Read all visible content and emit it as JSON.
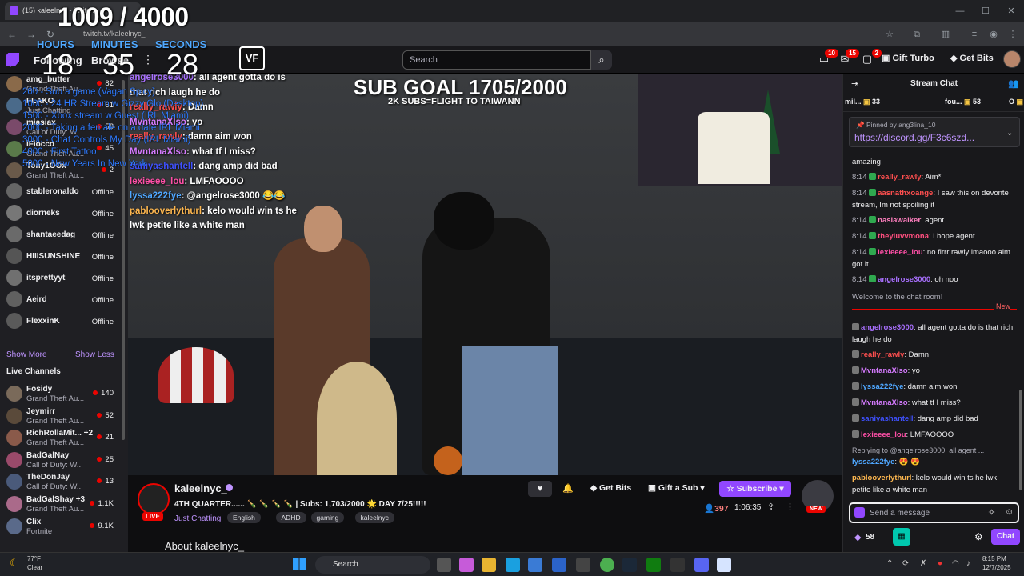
{
  "browser": {
    "tab_title": "(15) kaleelnyc - Twitch",
    "url": "twitch.tv/kaleelnyc_"
  },
  "overlay_timer": {
    "total": "1009 / 4000",
    "hours_label": "HOURS",
    "minutes_label": "MINUTES",
    "seconds_label": "SECONDS",
    "hours": "18",
    "minutes": "35",
    "seconds": "28"
  },
  "milestones": [
    "200 - Sub a game (Vagan Spicy)",
    "1000 - 24 HR Stream w Gizzy Glo (Desktop)",
    "1500 - Xbox stream w Guest (IRL Miami)",
    "2000 - Taking a female on a date IRL Miami",
    "3000 - Chat Controls My Day (IRL Miami)",
    "4000 - First Tattoo",
    "5000 - New Years In New York"
  ],
  "nav": {
    "following": "Following",
    "browse": "Browse",
    "search_placeholder": "Search",
    "logo_text": "VF",
    "notif_badge": "10",
    "inbox_badge": "15",
    "whisper_badge": "2",
    "gift_turbo": "Gift Turbo",
    "get_bits": "Get Bits"
  },
  "sidebar": {
    "followed": [
      {
        "name": "amg_butter",
        "game": "Grand Theft Au...",
        "viewers": "82",
        "color": "#8a6a4a"
      },
      {
        "name": "FLAKO",
        "game": "Just Chatting",
        "viewers": "61",
        "color": "#4a6a8a"
      },
      {
        "name": "miasiax",
        "game": "Call of Duty: W...",
        "viewers": "58",
        "color": "#7a4a6a"
      },
      {
        "name": "iFiocco",
        "game": "Grand Theft Au...",
        "viewers": "45",
        "color": "#5a7a4a"
      },
      {
        "name": "Tony1OOx",
        "game": "Grand Theft Au...",
        "viewers": "2",
        "color": "#6a5a4a"
      }
    ],
    "offline": [
      {
        "name": "stableronaldo",
        "status": "Offline",
        "color": "#666"
      },
      {
        "name": "diorneks",
        "status": "Offline",
        "color": "#777"
      },
      {
        "name": "shantaeedag",
        "status": "Offline",
        "color": "#6a6a6a"
      },
      {
        "name": "HIIISUNSHINE",
        "status": "Offline",
        "color": "#555"
      },
      {
        "name": "itsprettyyt",
        "status": "Offline",
        "color": "#707070"
      },
      {
        "name": "Aeird",
        "status": "Offline",
        "color": "#606060"
      },
      {
        "name": "FlexxinK",
        "status": "Offline",
        "color": "#5a5a5a"
      }
    ],
    "show_more": "Show More",
    "show_less": "Show Less",
    "live_title": "Live Channels",
    "live": [
      {
        "name": "Fosidy",
        "game": "Grand Theft Au...",
        "viewers": "140",
        "color": "#7a6a5a"
      },
      {
        "name": "Jeymirr",
        "game": "Grand Theft Au...",
        "viewers": "52",
        "color": "#5a4a3a"
      },
      {
        "name": "RichRollaMit... +2",
        "game": "Grand Theft Au...",
        "viewers": "21",
        "color": "#8a5a4a"
      },
      {
        "name": "BadGalNay",
        "game": "Call of Duty: W...",
        "viewers": "25",
        "color": "#9a4a6a"
      },
      {
        "name": "TheDonJay",
        "game": "Call of Duty: W...",
        "viewers": "13",
        "color": "#4a5a7a"
      },
      {
        "name": "BadGalShay +3",
        "game": "Grand Theft Au...",
        "viewers": "1.1K",
        "color": "#aa6a8a"
      },
      {
        "name": "Clix",
        "game": "Fortnite",
        "viewers": "9.1K",
        "color": "#5a6a8a"
      }
    ]
  },
  "video": {
    "goal_title": "SUB GOAL 1705/2000",
    "goal_sub": "2K SUBS=FLIGHT TO TAIWANN",
    "overlay_chat": [
      {
        "user": "angelrose3000",
        "msg": ": all agent gotta do is",
        "color": "#a970ff"
      },
      {
        "user": "",
        "msg": "that rich laugh he do",
        "color": "#fff"
      },
      {
        "user": "really_rawly",
        "msg": ": Damn",
        "color": "#ff4f4f"
      },
      {
        "user": "MvntanaXlso",
        "msg": ": yo",
        "color": "#d67bff"
      },
      {
        "user": "really_rawly",
        "msg": ": damn aim won",
        "color": "#ff4f4f"
      },
      {
        "user": "MvntanaXlso",
        "msg": ": what tf I miss?",
        "color": "#d67bff"
      },
      {
        "user": "saniyashantell",
        "msg": ": dang amp did bad",
        "color": "#3f51ff"
      },
      {
        "user": "lexieeee_lou",
        "msg": ": LMFAOOOO",
        "color": "#ff4fa7"
      },
      {
        "user": "lyssa222fye",
        "msg": ": @angelrose3000 😂😂",
        "color": "#4fa7ff"
      },
      {
        "user": "pablooverlythurl",
        "msg": ": kelo would win ts he",
        "color": "#ffb84f"
      },
      {
        "user": "",
        "msg": "lwk petite like a white man",
        "color": "#fff"
      }
    ]
  },
  "channel": {
    "name": "kaleelnyc_",
    "live": "LIVE",
    "title": "4TH QUARTER...... 🍾 🍾 🍾 🍾 | Subs: 1,703/2000 🌟 DAY 7/25!!!!!",
    "category": "Just Chatting",
    "tags": [
      "English",
      "ADHD",
      "gaming",
      "kaleelnyc"
    ],
    "get_bits": "Get Bits",
    "gift_sub": "Gift a Sub",
    "subscribe": "Subscribe",
    "new_badge": "NEW",
    "viewers": "397",
    "uptime": "1:06:35",
    "about": "About kaleelnyc_"
  },
  "chat": {
    "title": "Stream Chat",
    "hype": [
      {
        "user": "mil...",
        "count": "33"
      },
      {
        "user": "fou...",
        "count": "53"
      },
      {
        "user": "O",
        "count": ""
      }
    ],
    "pinned_by": "Pinned by",
    "pinned_user": "ang3lina_10",
    "pinned_link": "https://discord.gg/F3c6szd...",
    "messages": [
      {
        "time": "",
        "user": "",
        "text": "amazing",
        "color": "#efeff1"
      },
      {
        "time": "8:14",
        "user": "really_rawly",
        "text": ": Aim*",
        "color": "#ff4f4f"
      },
      {
        "time": "8:14",
        "user": "aasnathxoange",
        "text": ": I saw this on devonte stream, Im not spoiling it",
        "color": "#ff4f4f"
      },
      {
        "time": "8:14",
        "user": "nasiawalker",
        "text": ": agent",
        "color": "#ff7fbf"
      },
      {
        "time": "8:14",
        "user": "theyluvvmona",
        "text": ": i hope agent",
        "color": "#ff4f7f"
      },
      {
        "time": "8:14",
        "user": "lexieeee_lou",
        "text": ": no firrr rawly lmaooo aim got it",
        "color": "#ff4fa7"
      },
      {
        "time": "8:14",
        "user": "angelrose3000",
        "text": ": oh noo",
        "color": "#a970ff"
      }
    ],
    "welcome": "Welcome to the chat room!",
    "new_label": "New",
    "new_messages": [
      {
        "user": "angelrose3000",
        "text": ": all agent gotta do is that rich laugh he do",
        "color": "#a970ff"
      },
      {
        "user": "really_rawly",
        "text": ": Damn",
        "color": "#ff4f4f"
      },
      {
        "user": "MvntanaXlso",
        "text": ": yo",
        "color": "#d67bff"
      },
      {
        "user": "lyssa222fye",
        "text": ": damn aim won",
        "color": "#4fa7ff"
      },
      {
        "user": "MvntanaXlso",
        "text": ": what tf I miss?",
        "color": "#d67bff"
      },
      {
        "user": "saniyashantell",
        "text": ": dang amp did bad",
        "color": "#3f51ff"
      },
      {
        "user": "lexieeee_lou",
        "text": ": LMFAOOOO",
        "color": "#ff4fa7"
      }
    ],
    "reply_to": "Replying to @angelrose3000: all agent ...",
    "reply_user": "lyssa222fye",
    "reply_text": ": 😍 😍",
    "last_user": "pablooverlythurl",
    "last_text": ": kelo would win ts he lwk petite like a white man",
    "input_placeholder": "Send a message",
    "bits": "58",
    "send": "Chat"
  },
  "taskbar": {
    "temp": "77°F",
    "condition": "Clear",
    "search": "Search",
    "time": "8:15 PM",
    "date": "12/7/2025"
  }
}
